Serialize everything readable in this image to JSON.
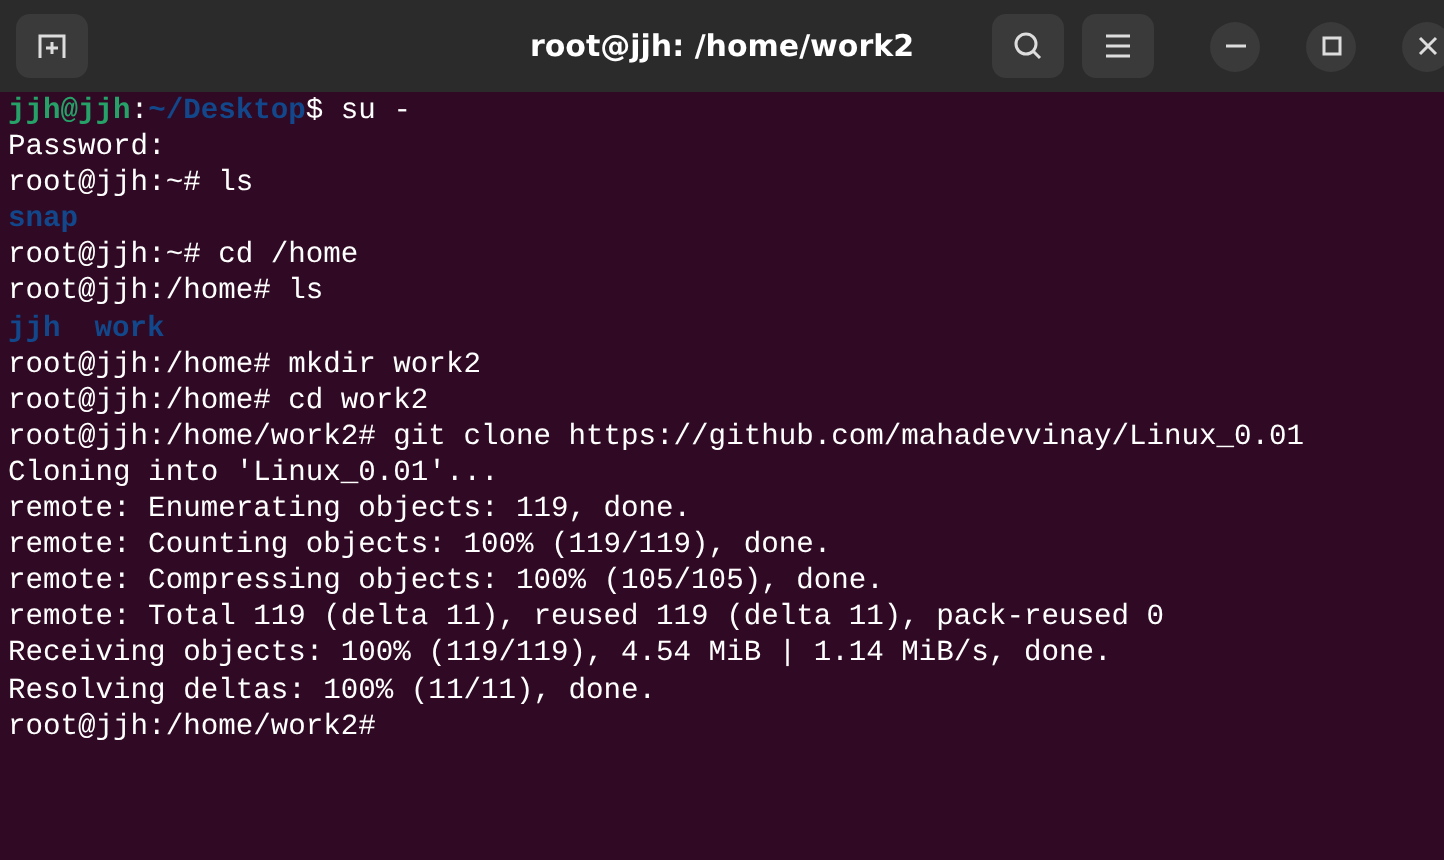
{
  "window": {
    "title": "root@jjh: /home/work2"
  },
  "terminal": {
    "lines": [
      [
        {
          "kind": "user",
          "text": "jjh@jjh"
        },
        {
          "kind": "plain",
          "text": ":"
        },
        {
          "kind": "path",
          "text": "~/Desktop"
        },
        {
          "kind": "plain",
          "text": "$ su -"
        }
      ],
      [
        {
          "kind": "plain",
          "text": "Password:"
        }
      ],
      [
        {
          "kind": "plain",
          "text": "root@jjh:~# ls"
        }
      ],
      [
        {
          "kind": "dir",
          "text": "snap"
        }
      ],
      [
        {
          "kind": "plain",
          "text": "root@jjh:~# cd /home"
        }
      ],
      [
        {
          "kind": "plain",
          "text": "root@jjh:/home# ls"
        }
      ],
      [
        {
          "kind": "dir",
          "text": "jjh"
        },
        {
          "kind": "dir",
          "text": "work"
        }
      ],
      [
        {
          "kind": "plain",
          "text": "root@jjh:/home# mkdir work2"
        }
      ],
      [
        {
          "kind": "plain",
          "text": "root@jjh:/home# cd work2"
        }
      ],
      [
        {
          "kind": "plain",
          "text": "root@jjh:/home/work2# git clone https://github.com/mahadevvinay/Linux_0.01"
        }
      ],
      [
        {
          "kind": "plain",
          "text": "Cloning into 'Linux_0.01'..."
        }
      ],
      [
        {
          "kind": "plain",
          "text": "remote: Enumerating objects: 119, done."
        }
      ],
      [
        {
          "kind": "plain",
          "text": "remote: Counting objects: 100% (119/119), done."
        }
      ],
      [
        {
          "kind": "plain",
          "text": "remote: Compressing objects: 100% (105/105), done."
        }
      ],
      [
        {
          "kind": "plain",
          "text": "remote: Total 119 (delta 11), reused 119 (delta 11), pack-reused 0"
        }
      ],
      [
        {
          "kind": "plain",
          "text": "Receiving objects: 100% (119/119), 4.54 MiB | 1.14 MiB/s, done."
        }
      ],
      [
        {
          "kind": "plain",
          "text": "Resolving deltas: 100% (11/11), done."
        }
      ],
      [
        {
          "kind": "plain",
          "text": "root@jjh:/home/work2#"
        }
      ]
    ]
  }
}
